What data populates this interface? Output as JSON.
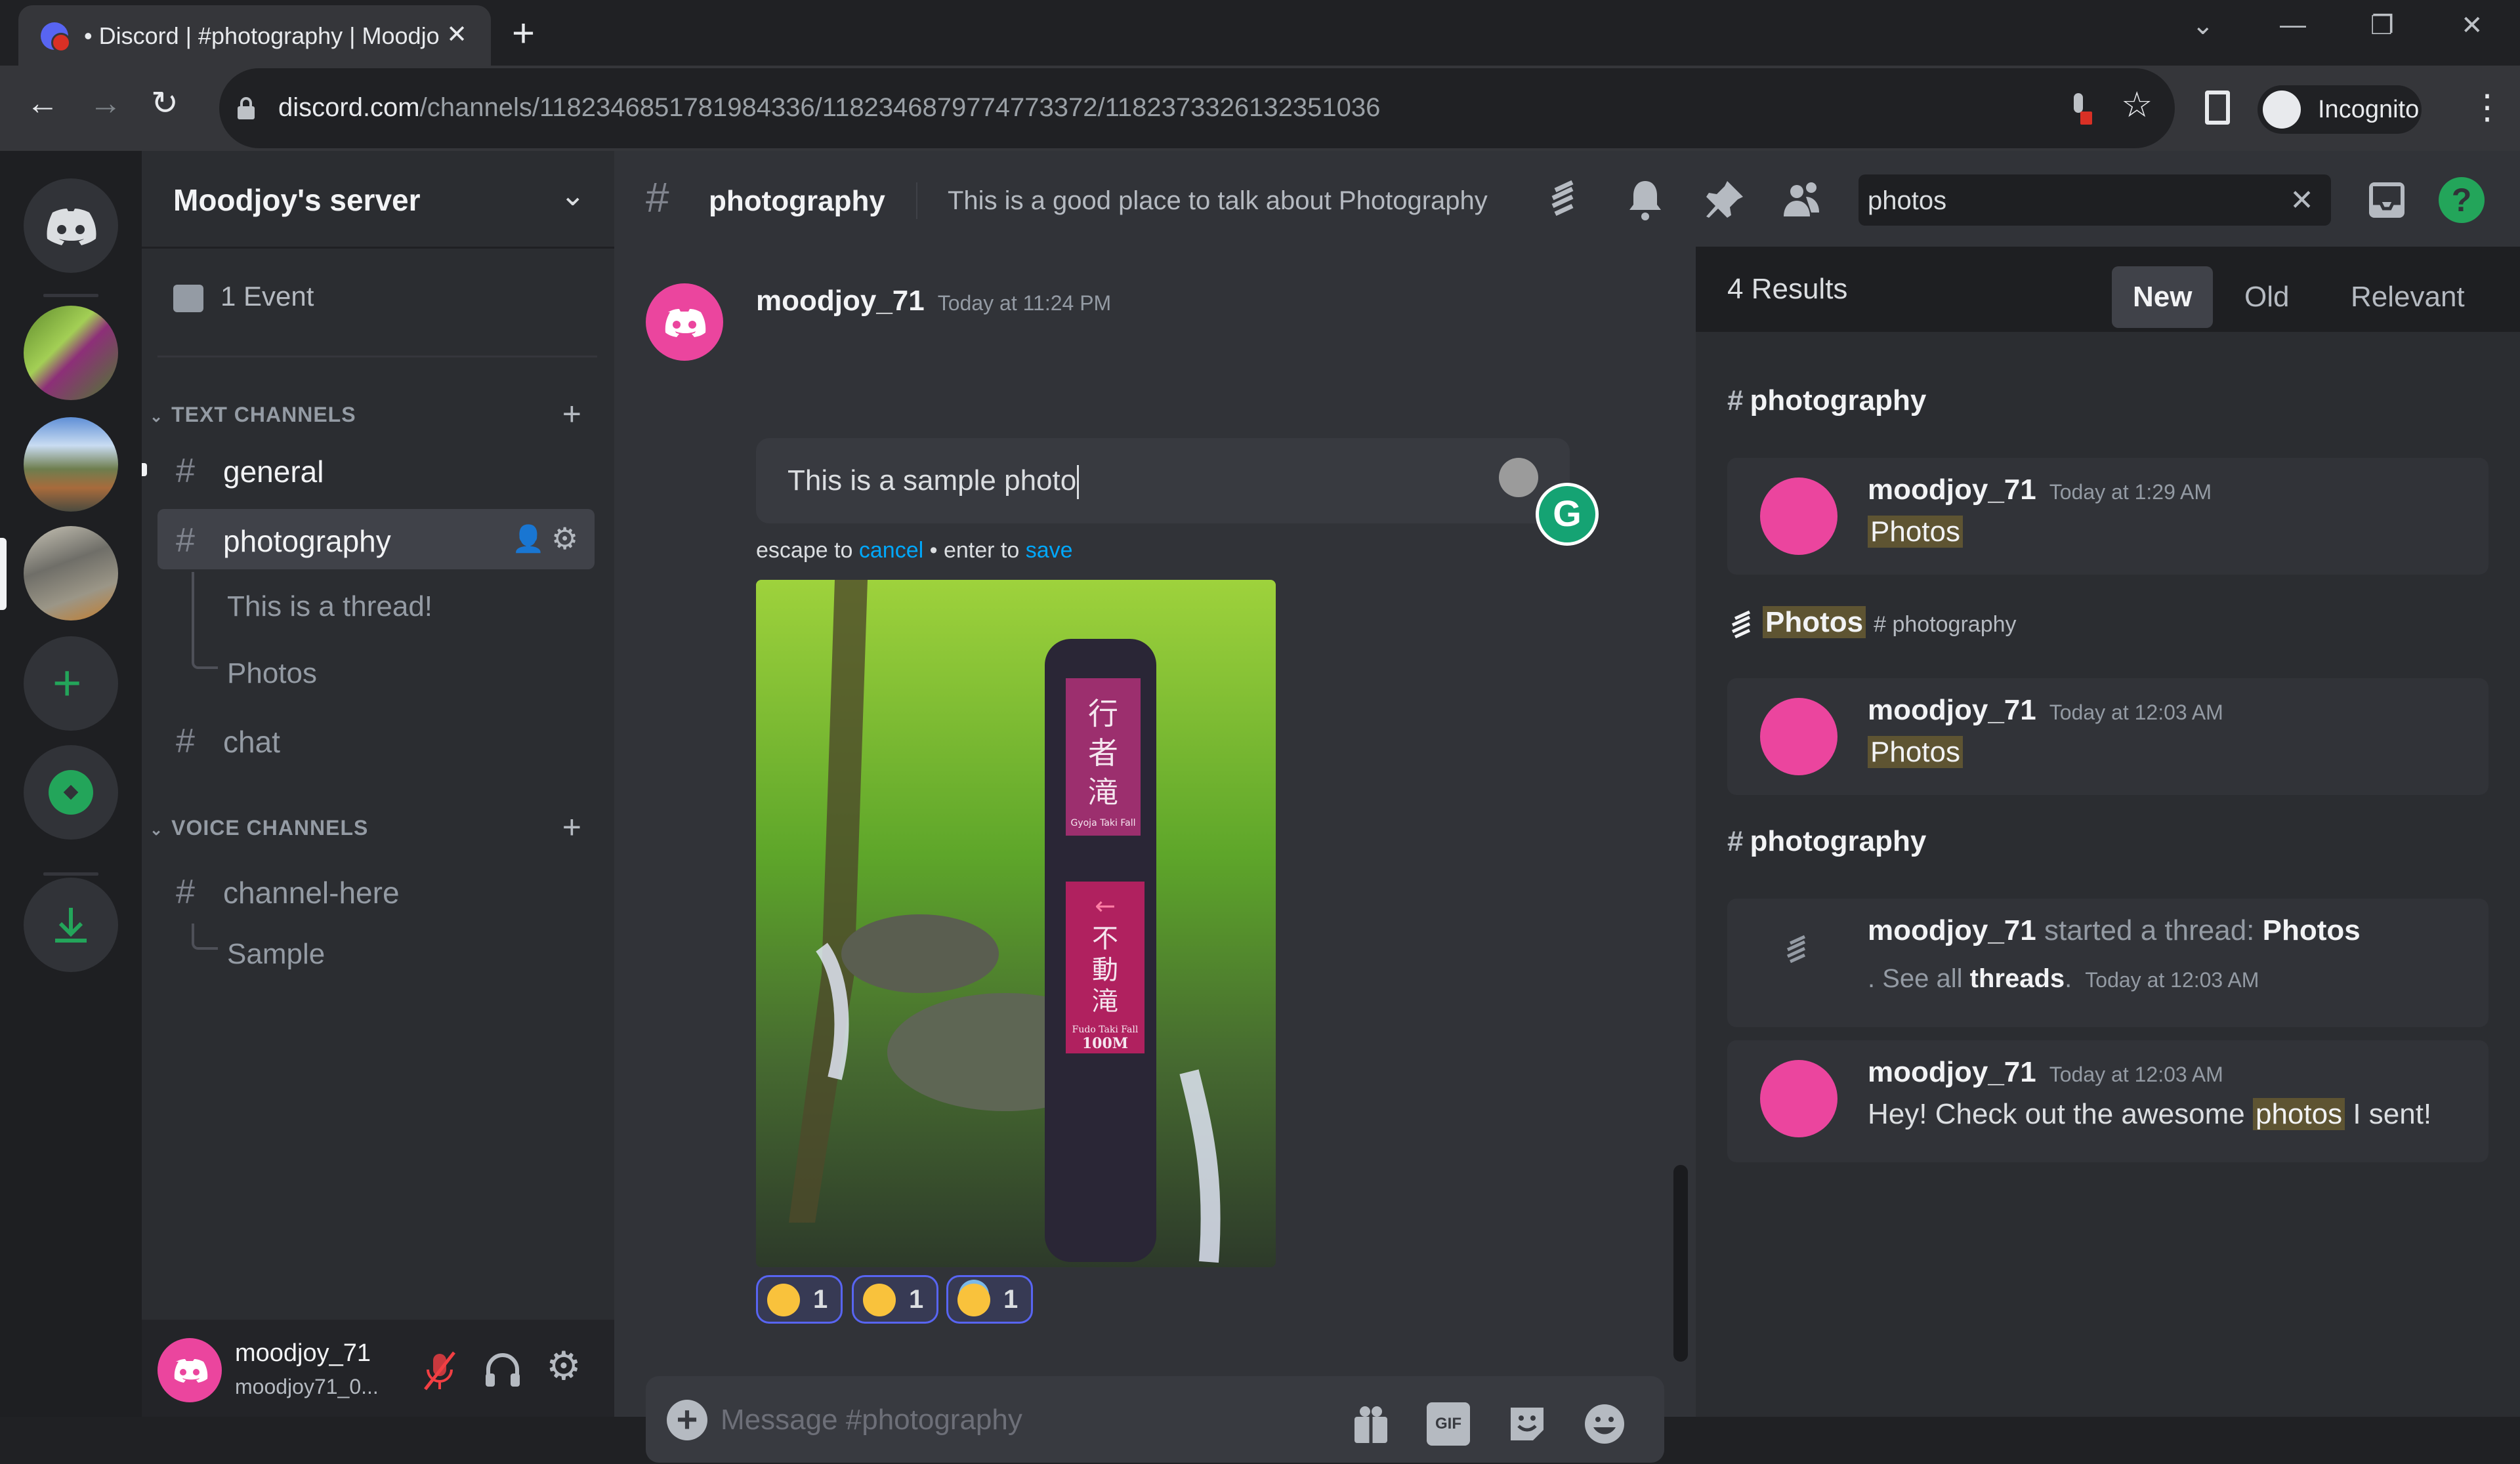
{
  "browser": {
    "tab_title": "• Discord | #photography | Moodjoy's server",
    "url_host": "discord.com",
    "url_path": "/channels/1182346851781984336/1182346879774773372/1182373326132351036",
    "profile_label": "Incognito"
  },
  "server": {
    "name": "Moodjoy's server",
    "events_label": "1 Event",
    "text_category": "TEXT CHANNELS",
    "voice_category": "VOICE CHANNELS",
    "text_channels": [
      {
        "name": "general",
        "unread": true
      },
      {
        "name": "photography",
        "active": true
      },
      {
        "name": "chat"
      }
    ],
    "threads": [
      "This is a thread!",
      "Photos"
    ],
    "voice_channels": [
      {
        "name": "channel-here"
      }
    ],
    "voice_threads": [
      "Sample"
    ]
  },
  "user": {
    "display_name": "moodjoy_71",
    "username": "moodjoy71_0...",
    "mic_muted": true
  },
  "channel": {
    "name": "photography",
    "topic": "This is a good place to talk about Photography",
    "search_value": "photos"
  },
  "message": {
    "author": "moodjoy_71",
    "timestamp": "Today at 11:24 PM",
    "edit_text": "This is a sample photo",
    "hint_prefix": "escape to ",
    "hint_cancel": "cancel",
    "hint_mid": " • enter to ",
    "hint_save": "save",
    "image_alt": "Forest waterfall with sign: 行者滝 Gyoja Taki Fall / 不動滝まで Fudo Taki Fall 100M",
    "reactions": [
      {
        "emoji": "yum",
        "count": "1"
      },
      {
        "emoji": "pleading",
        "count": "1"
      },
      {
        "emoji": "innocent",
        "count": "1"
      }
    ]
  },
  "composer": {
    "placeholder": "Message #photography"
  },
  "search_results": {
    "count_label": "4 Results",
    "sort_options": [
      "New",
      "Old",
      "Relevant"
    ],
    "active_sort": "New",
    "groups": [
      {
        "channel": "photography",
        "results": [
          {
            "author": "moodjoy_71",
            "timestamp": "Today at 1:29 AM",
            "highlight": "Photos"
          }
        ]
      },
      {
        "thread": "Photos",
        "parent_channel": "photography",
        "results": [
          {
            "author": "moodjoy_71",
            "timestamp": "Today at 12:03 AM",
            "highlight": "Photos"
          }
        ]
      },
      {
        "channel": "photography",
        "results": [
          {
            "author": "moodjoy_71",
            "system_text": "started a thread:",
            "thread_name": "Photos",
            "see_all_prefix": ". See all",
            "see_all_link": "threads",
            "timestamp": "Today at 12:03 AM"
          },
          {
            "author": "moodjoy_71",
            "timestamp": "Today at 12:03 AM",
            "text_before": "Hey! Check out the awesome",
            "highlight": "photos",
            "text_after": "I sent!"
          }
        ]
      }
    ]
  }
}
